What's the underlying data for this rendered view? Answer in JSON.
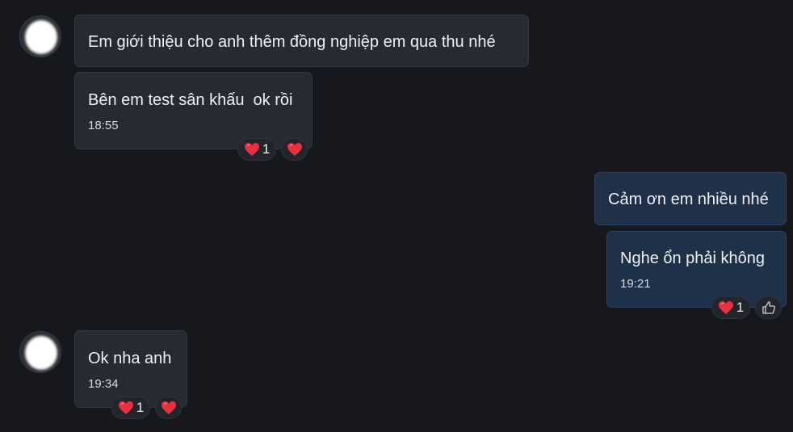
{
  "messages": [
    {
      "text": "Em giới thiệu cho anh thêm đồng nghiệp em qua thu nhé"
    },
    {
      "text": "Bên em test sân khấu  ok rồi",
      "time": "18:55",
      "reaction_count": "1"
    },
    {
      "text": "Cảm ơn em nhiều nhé"
    },
    {
      "text": "Nghe ổn phải không",
      "time": "19:21",
      "reaction_count": "1"
    },
    {
      "text": "Ok nha anh",
      "time": "19:34",
      "reaction_count": "1"
    }
  ],
  "icons": {
    "heart": "heart-icon",
    "like": "thumbs-up-icon"
  },
  "colors": {
    "background": "#16181d",
    "incoming_bubble": "#272a30",
    "outgoing_bubble": "#1f3049",
    "heart": "#e8303f"
  }
}
